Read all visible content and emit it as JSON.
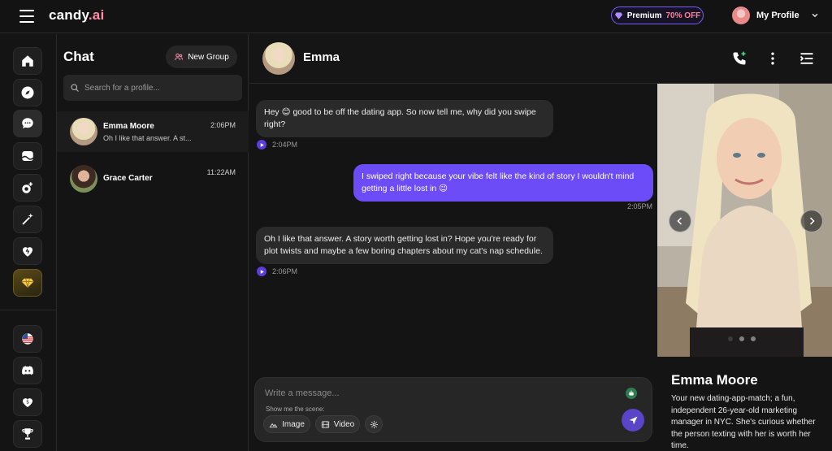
{
  "app": {
    "logo_main": "candy",
    "logo_suffix": ".ai",
    "premium_label": "Premium",
    "premium_discount": "70% OFF",
    "profile_label": "My Profile"
  },
  "rail": {
    "icons": [
      "home-icon",
      "compass-icon",
      "chat-icon",
      "gallery-icon",
      "create-character-icon",
      "magic-wand-icon",
      "heart-icon",
      "gem-icon",
      "us-flag-icon",
      "discord-icon",
      "affiliate-icon",
      "trophy-icon"
    ]
  },
  "chatlist": {
    "title": "Chat",
    "new_group_label": "New Group",
    "search_placeholder": "Search for a profile...",
    "contacts": [
      {
        "name": "Emma Moore",
        "preview": "Oh I like that answer. A st...",
        "time": "2:06PM"
      },
      {
        "name": "Grace Carter",
        "preview": "",
        "time": "11:22AM"
      }
    ]
  },
  "conversation": {
    "name": "Emma",
    "messages": [
      {
        "direction": "in",
        "text": "Hey 😊 good to be off the dating app. So now tell me, why did you swipe right?",
        "time": "2:04PM"
      },
      {
        "direction": "out",
        "text": "I swiped right because your vibe felt like the kind of story I wouldn't mind getting a little lost in 😉",
        "time": "2:05PM"
      },
      {
        "direction": "in",
        "text": "Oh I like that answer. A story worth getting lost in? Hope you're ready for plot twists and maybe a few boring chapters about my cat's nap schedule.",
        "time": "2:06PM"
      }
    ],
    "composer": {
      "placeholder": "Write a message...",
      "show_me_label": "Show me the scene:",
      "image_label": "Image",
      "video_label": "Video"
    }
  },
  "profile_panel": {
    "name": "Emma Moore",
    "description": "Your new dating-app-match; a fun, independent 26-year-old marketing manager in NYC. She's curious whether the person texting with her is worth her time."
  },
  "colors": {
    "accent": "#6b4cf6",
    "background": "#141414",
    "bubble_in": "#2a2a2a",
    "premium_border": "#7a5cff",
    "logo_accent": "#ff8ba7"
  }
}
